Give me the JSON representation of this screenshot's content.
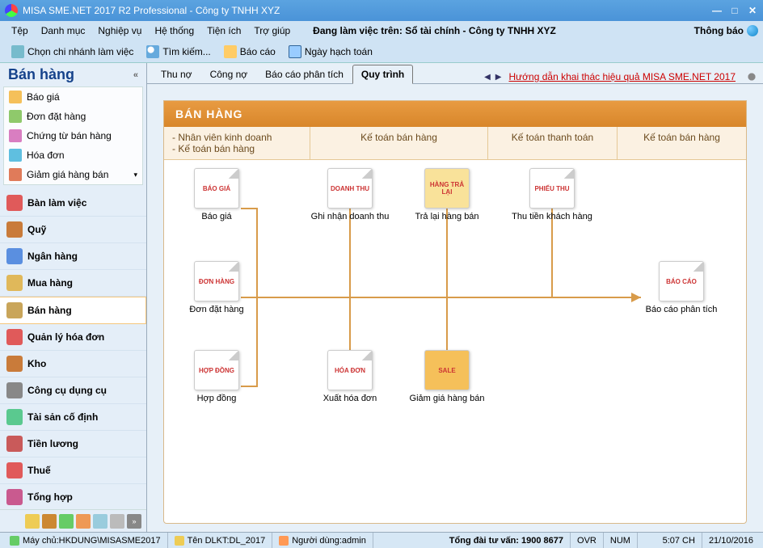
{
  "titlebar": {
    "title": "MISA SME.NET 2017 R2 Professional - Công ty TNHH XYZ"
  },
  "menu": {
    "items": [
      "Tệp",
      "Danh mục",
      "Nghiệp vụ",
      "Hệ thống",
      "Tiện ích",
      "Trợ giúp"
    ],
    "working_prefix": "Đang làm việc trên: ",
    "working_value": "Sổ tài chính - Công ty TNHH XYZ",
    "notify": "Thông báo"
  },
  "toolbar": {
    "branch": "Chọn chi nhánh làm việc",
    "search": "Tìm kiếm...",
    "report": "Báo cáo",
    "acct_date": "Ngày hạch toán"
  },
  "sidebar": {
    "title": "Bán hàng",
    "items": [
      {
        "label": "Báo giá",
        "color": "#f5c05a"
      },
      {
        "label": "Đơn đặt hàng",
        "color": "#8fc96b"
      },
      {
        "label": "Chứng từ bán hàng",
        "color": "#d97ec1"
      },
      {
        "label": "Hóa đơn",
        "color": "#5fbfe0"
      },
      {
        "label": "Giảm giá hàng bán",
        "color": "#e07b5a",
        "dd": true
      }
    ],
    "modules": [
      {
        "label": "Bàn làm việc",
        "color": "#e05a5a"
      },
      {
        "label": "Quỹ",
        "color": "#c97b3a"
      },
      {
        "label": "Ngân hàng",
        "color": "#5a8fe0"
      },
      {
        "label": "Mua hàng",
        "color": "#e0b85a"
      },
      {
        "label": "Bán hàng",
        "color": "#c9a55a",
        "active": true
      },
      {
        "label": "Quản lý hóa đơn",
        "color": "#e05a5a"
      },
      {
        "label": "Kho",
        "color": "#c97b3a"
      },
      {
        "label": "Công cụ dụng cụ",
        "color": "#888"
      },
      {
        "label": "Tài sản cố định",
        "color": "#5ac98f"
      },
      {
        "label": "Tiền lương",
        "color": "#c95a5a"
      },
      {
        "label": "Thuế",
        "color": "#e05a5a"
      },
      {
        "label": "Tổng hợp",
        "color": "#c95a8f"
      }
    ]
  },
  "tabs": {
    "items": [
      "Thu nợ",
      "Công nợ",
      "Báo cáo phân tích",
      "Quy trình"
    ],
    "active": 3,
    "link": "Hướng dẫn khai thác hiệu quả MISA SME.NET 2017"
  },
  "workflow": {
    "title": "BÁN HÀNG",
    "cols": {
      "c1a": "- Nhân viên kinh doanh",
      "c1b": "- Kế toán bán hàng",
      "c2": "Kế toán bán hàng",
      "c3": "Kế toán thanh toán",
      "c4": "Kế toán bán hàng"
    },
    "nodes": {
      "baogia": {
        "label": "Báo giá",
        "tag": "BÁO GIÁ"
      },
      "dondat": {
        "label": "Đơn đặt hàng",
        "tag": "ĐƠN HÀNG"
      },
      "hopdong": {
        "label": "Hợp đồng",
        "tag": "HỢP ĐỒNG"
      },
      "ghinhan": {
        "label": "Ghi nhận doanh thu",
        "tag": "DOANH THU"
      },
      "xuathd": {
        "label": "Xuất hóa đơn",
        "tag": "HÓA ĐƠN"
      },
      "tralai": {
        "label": "Trả lại hàng bán",
        "tag": "HÀNG TRẢ LẠI"
      },
      "giamgia": {
        "label": "Giảm giá hàng bán",
        "tag": "SALE"
      },
      "thutien": {
        "label": "Thu tiền khách hàng",
        "tag": "PHIẾU THU"
      },
      "baocao": {
        "label": "Báo cáo phân tích",
        "tag": "BÁO CÁO"
      }
    }
  },
  "status": {
    "server_label": "Máy chủ: ",
    "server": "HKDUNG\\MISASME2017",
    "db_label": "Tên DLKT: ",
    "db": "DL_2017",
    "user_label": "Người dùng: ",
    "user": "admin",
    "hotline_label": "Tổng đài tư vấn: ",
    "hotline": "1900 8677",
    "ovr": "OVR",
    "num": "NUM",
    "time": "5:07 CH",
    "date": "21/10/2016"
  }
}
